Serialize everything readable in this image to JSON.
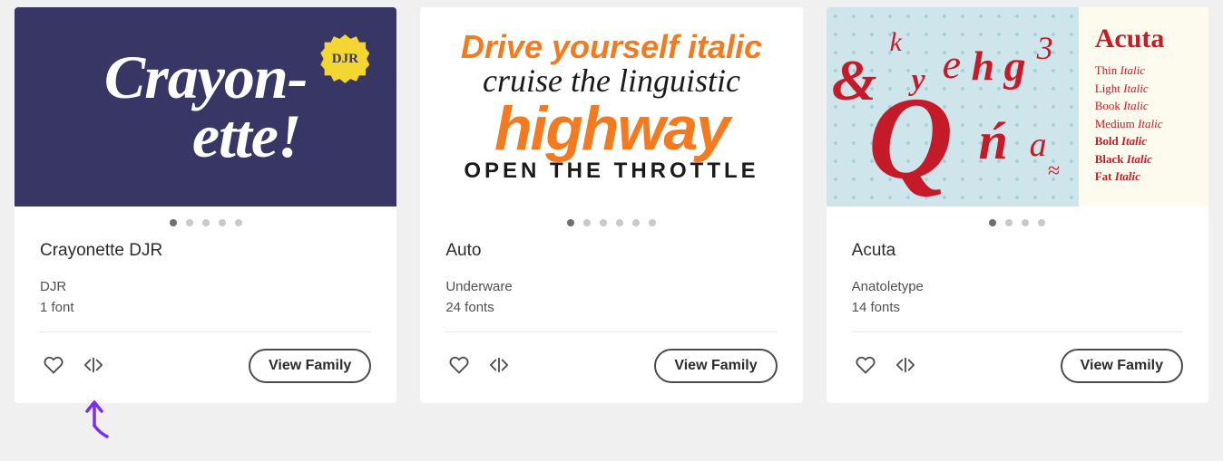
{
  "cards": [
    {
      "title": "Crayonette DJR",
      "foundry": "DJR",
      "count": "1 font",
      "dotCount": 5,
      "activeDot": 0,
      "viewLabel": "View Family",
      "preview": {
        "text_l1": "Crayon-",
        "text_l2": "ette!",
        "badge": "DJR"
      }
    },
    {
      "title": "Auto",
      "foundry": "Underware",
      "count": "24 fonts",
      "dotCount": 6,
      "activeDot": 0,
      "viewLabel": "View Family",
      "preview": {
        "l1": "Drive yourself italic",
        "l2": "cruise the linguistic",
        "l3": "highway",
        "l4": "OPEN THE THROTTLE"
      }
    },
    {
      "title": "Acuta",
      "foundry": "Anatoletype",
      "count": "14 fonts",
      "dotCount": 4,
      "activeDot": 0,
      "viewLabel": "View Family",
      "preview": {
        "name": "Acuta",
        "glyphs": [
          "&",
          "k",
          "y",
          "e",
          "h",
          "g",
          "3",
          "Q",
          "ń",
          "a",
          "≈"
        ],
        "styles": [
          {
            "w": "Thin",
            "i": "Italic",
            "bold": false
          },
          {
            "w": "Light",
            "i": "Italic",
            "bold": false
          },
          {
            "w": "Book",
            "i": "Italic",
            "bold": false
          },
          {
            "w": "Medium",
            "i": "Italic",
            "bold": false
          },
          {
            "w": "Bold",
            "i": "Italic",
            "bold": true
          },
          {
            "w": "Black",
            "i": "Italic",
            "bold": true
          },
          {
            "w": "Fat",
            "i": "Italic",
            "bold": true
          }
        ]
      }
    }
  ]
}
